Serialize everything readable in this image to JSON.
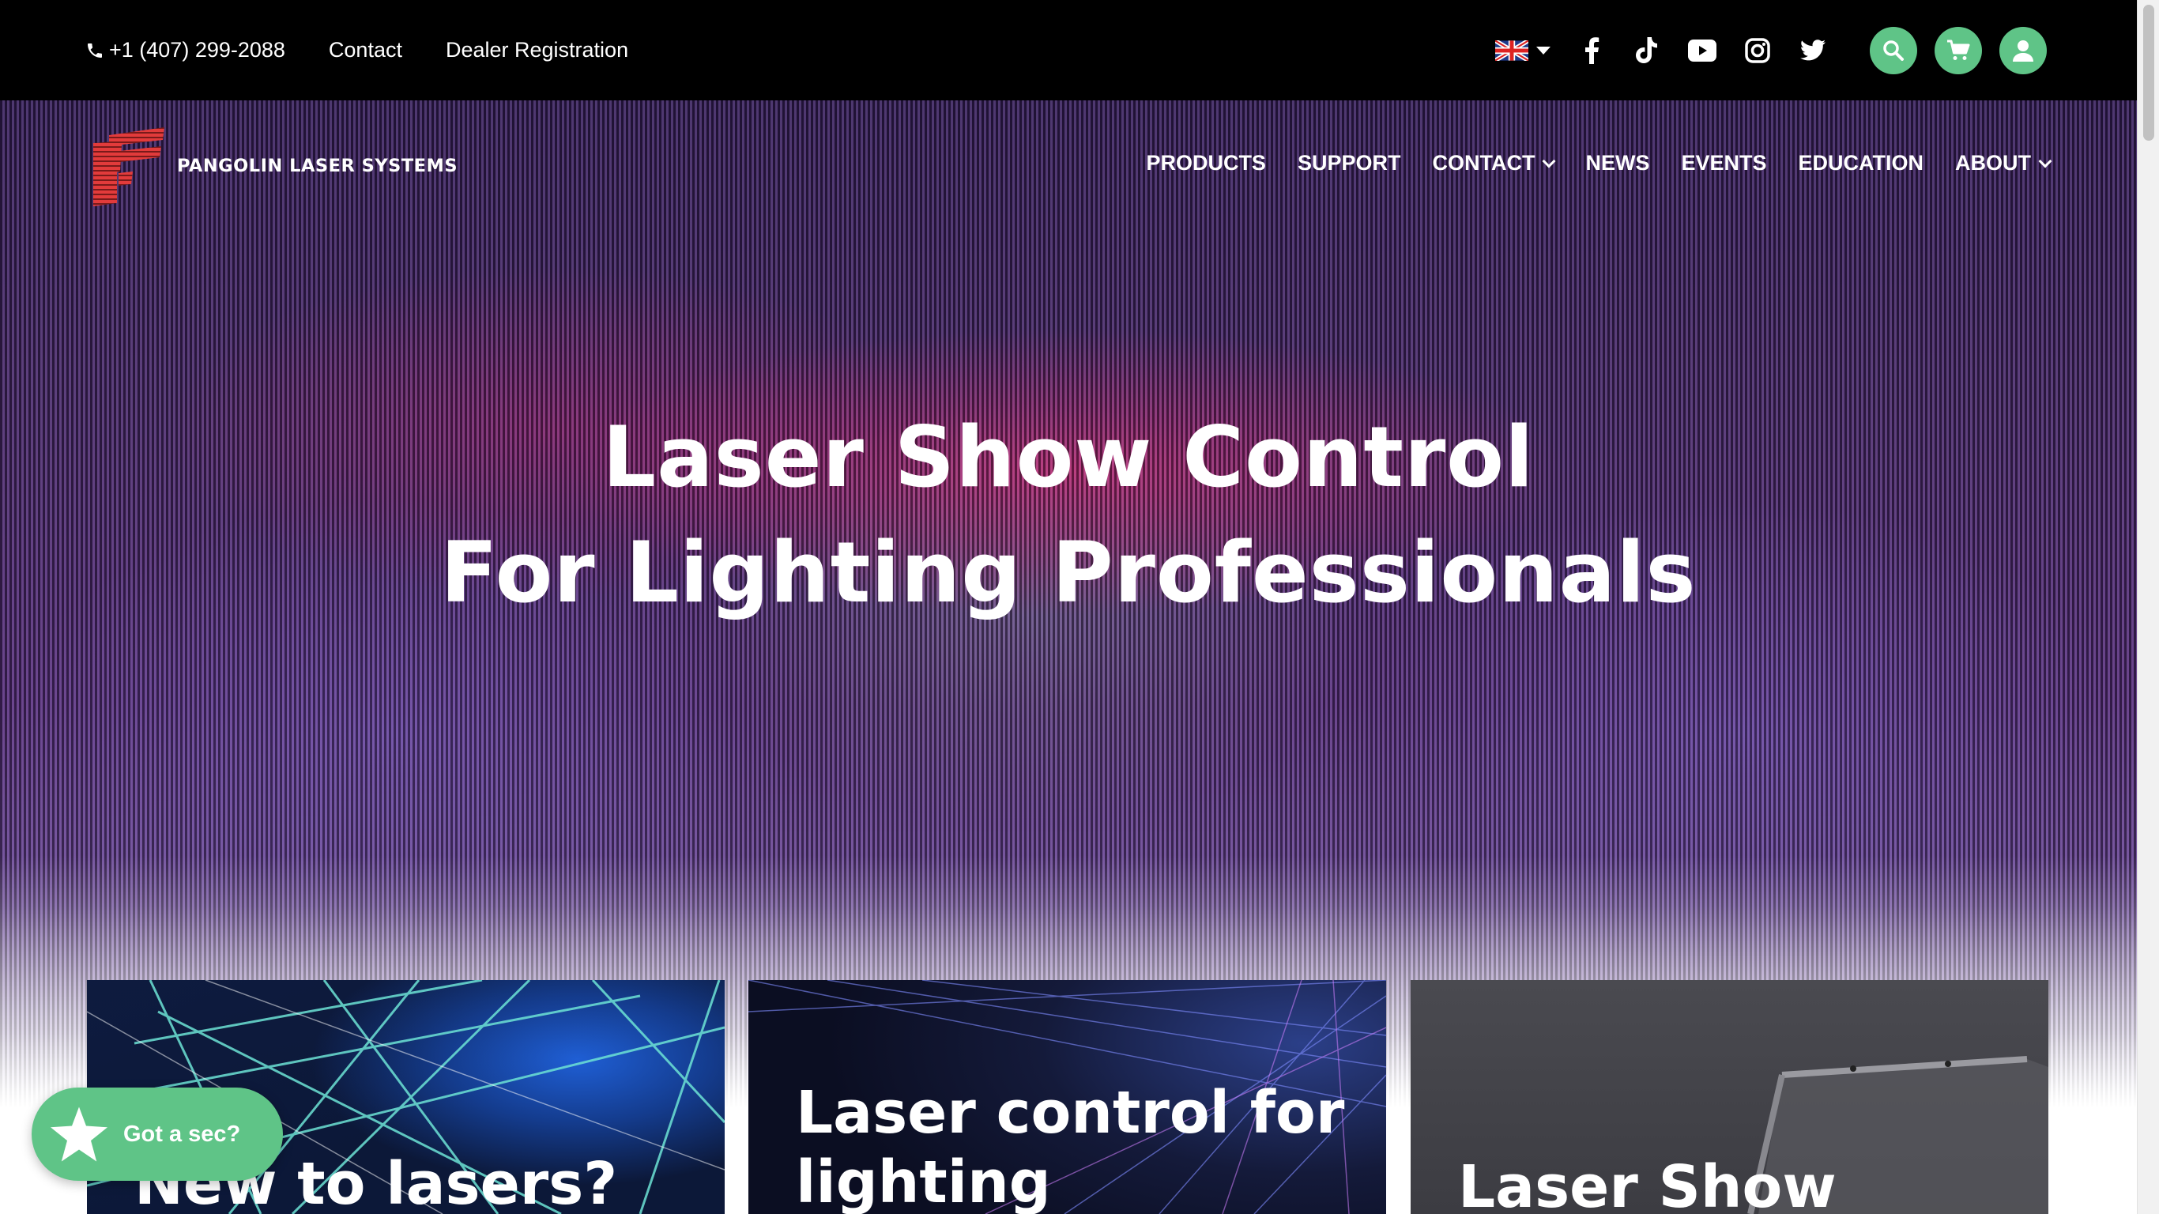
{
  "topbar": {
    "phone": "+1 (407) 299-2088",
    "contact": "Contact",
    "dealer": "Dealer Registration",
    "language_flag": "uk-flag-icon",
    "social": [
      "facebook-icon",
      "tiktok-icon",
      "youtube-icon",
      "instagram-icon",
      "twitter-icon"
    ],
    "buttons": [
      "search-icon",
      "cart-icon",
      "account-icon"
    ],
    "accent": "#5fc487"
  },
  "brand": {
    "name": "PANGOLIN LASER SYSTEMS",
    "logo_color": "#e03a3a"
  },
  "nav": {
    "items": [
      "PRODUCTS",
      "SUPPORT",
      "CONTACT",
      "NEWS",
      "EVENTS",
      "EDUCATION",
      "ABOUT"
    ]
  },
  "hero": {
    "line1": "Laser Show Control",
    "line2": "For Lighting Professionals"
  },
  "cards": [
    {
      "title": "New to lasers?"
    },
    {
      "title": "Laser control for lighting"
    },
    {
      "title": "Laser Show"
    }
  ],
  "feedback": {
    "label": "Got a sec?"
  }
}
